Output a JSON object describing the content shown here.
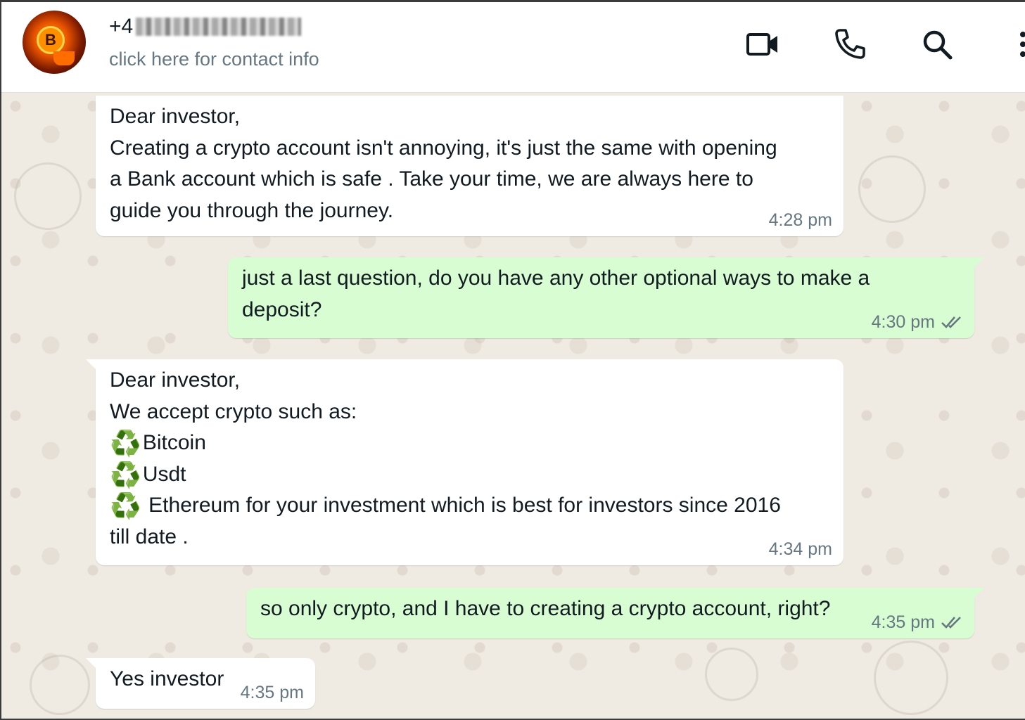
{
  "header": {
    "contact_prefix": "+4",
    "contact_sub": "click here for contact info",
    "avatar_letter": "B",
    "icons": [
      "video-call-icon",
      "voice-call-icon",
      "search-icon",
      "menu-icon"
    ]
  },
  "messages": [
    {
      "direction": "incoming",
      "lines": [
        "Dear investor,",
        "Creating a crypto account isn't annoying, it's just the same with opening",
        "a Bank account which is safe . Take your time, we are always here to",
        "guide you through the journey."
      ],
      "time": "4:28 pm"
    },
    {
      "direction": "outgoing",
      "lines": [
        "just a last question, do you have any other optional ways to make a",
        "deposit?"
      ],
      "time": "4:30 pm",
      "status": "read"
    },
    {
      "direction": "incoming",
      "lines": [
        "Dear investor,",
        "We accept crypto such as:"
      ],
      "items": [
        {
          "emoji": "♻️",
          "text": "Bitcoin"
        },
        {
          "emoji": "♻️",
          "text": "Usdt"
        },
        {
          "emoji": "♻️",
          "text": " Ethereum for your investment which is best for investors since 2016"
        }
      ],
      "tail_line": "till date .",
      "time": "4:34 pm"
    },
    {
      "direction": "outgoing",
      "lines": [
        "so only crypto, and I have to creating a crypto account, right?"
      ],
      "time": "4:35 pm",
      "status": "read"
    },
    {
      "direction": "incoming",
      "lines": [
        "Yes investor"
      ],
      "time": "4:35 pm"
    }
  ],
  "colors": {
    "chat_background": "#efeae2",
    "incoming_bubble": "#ffffff",
    "outgoing_bubble": "#d9fdd3",
    "secondary_text": "#667781",
    "primary_text": "#111b21"
  }
}
